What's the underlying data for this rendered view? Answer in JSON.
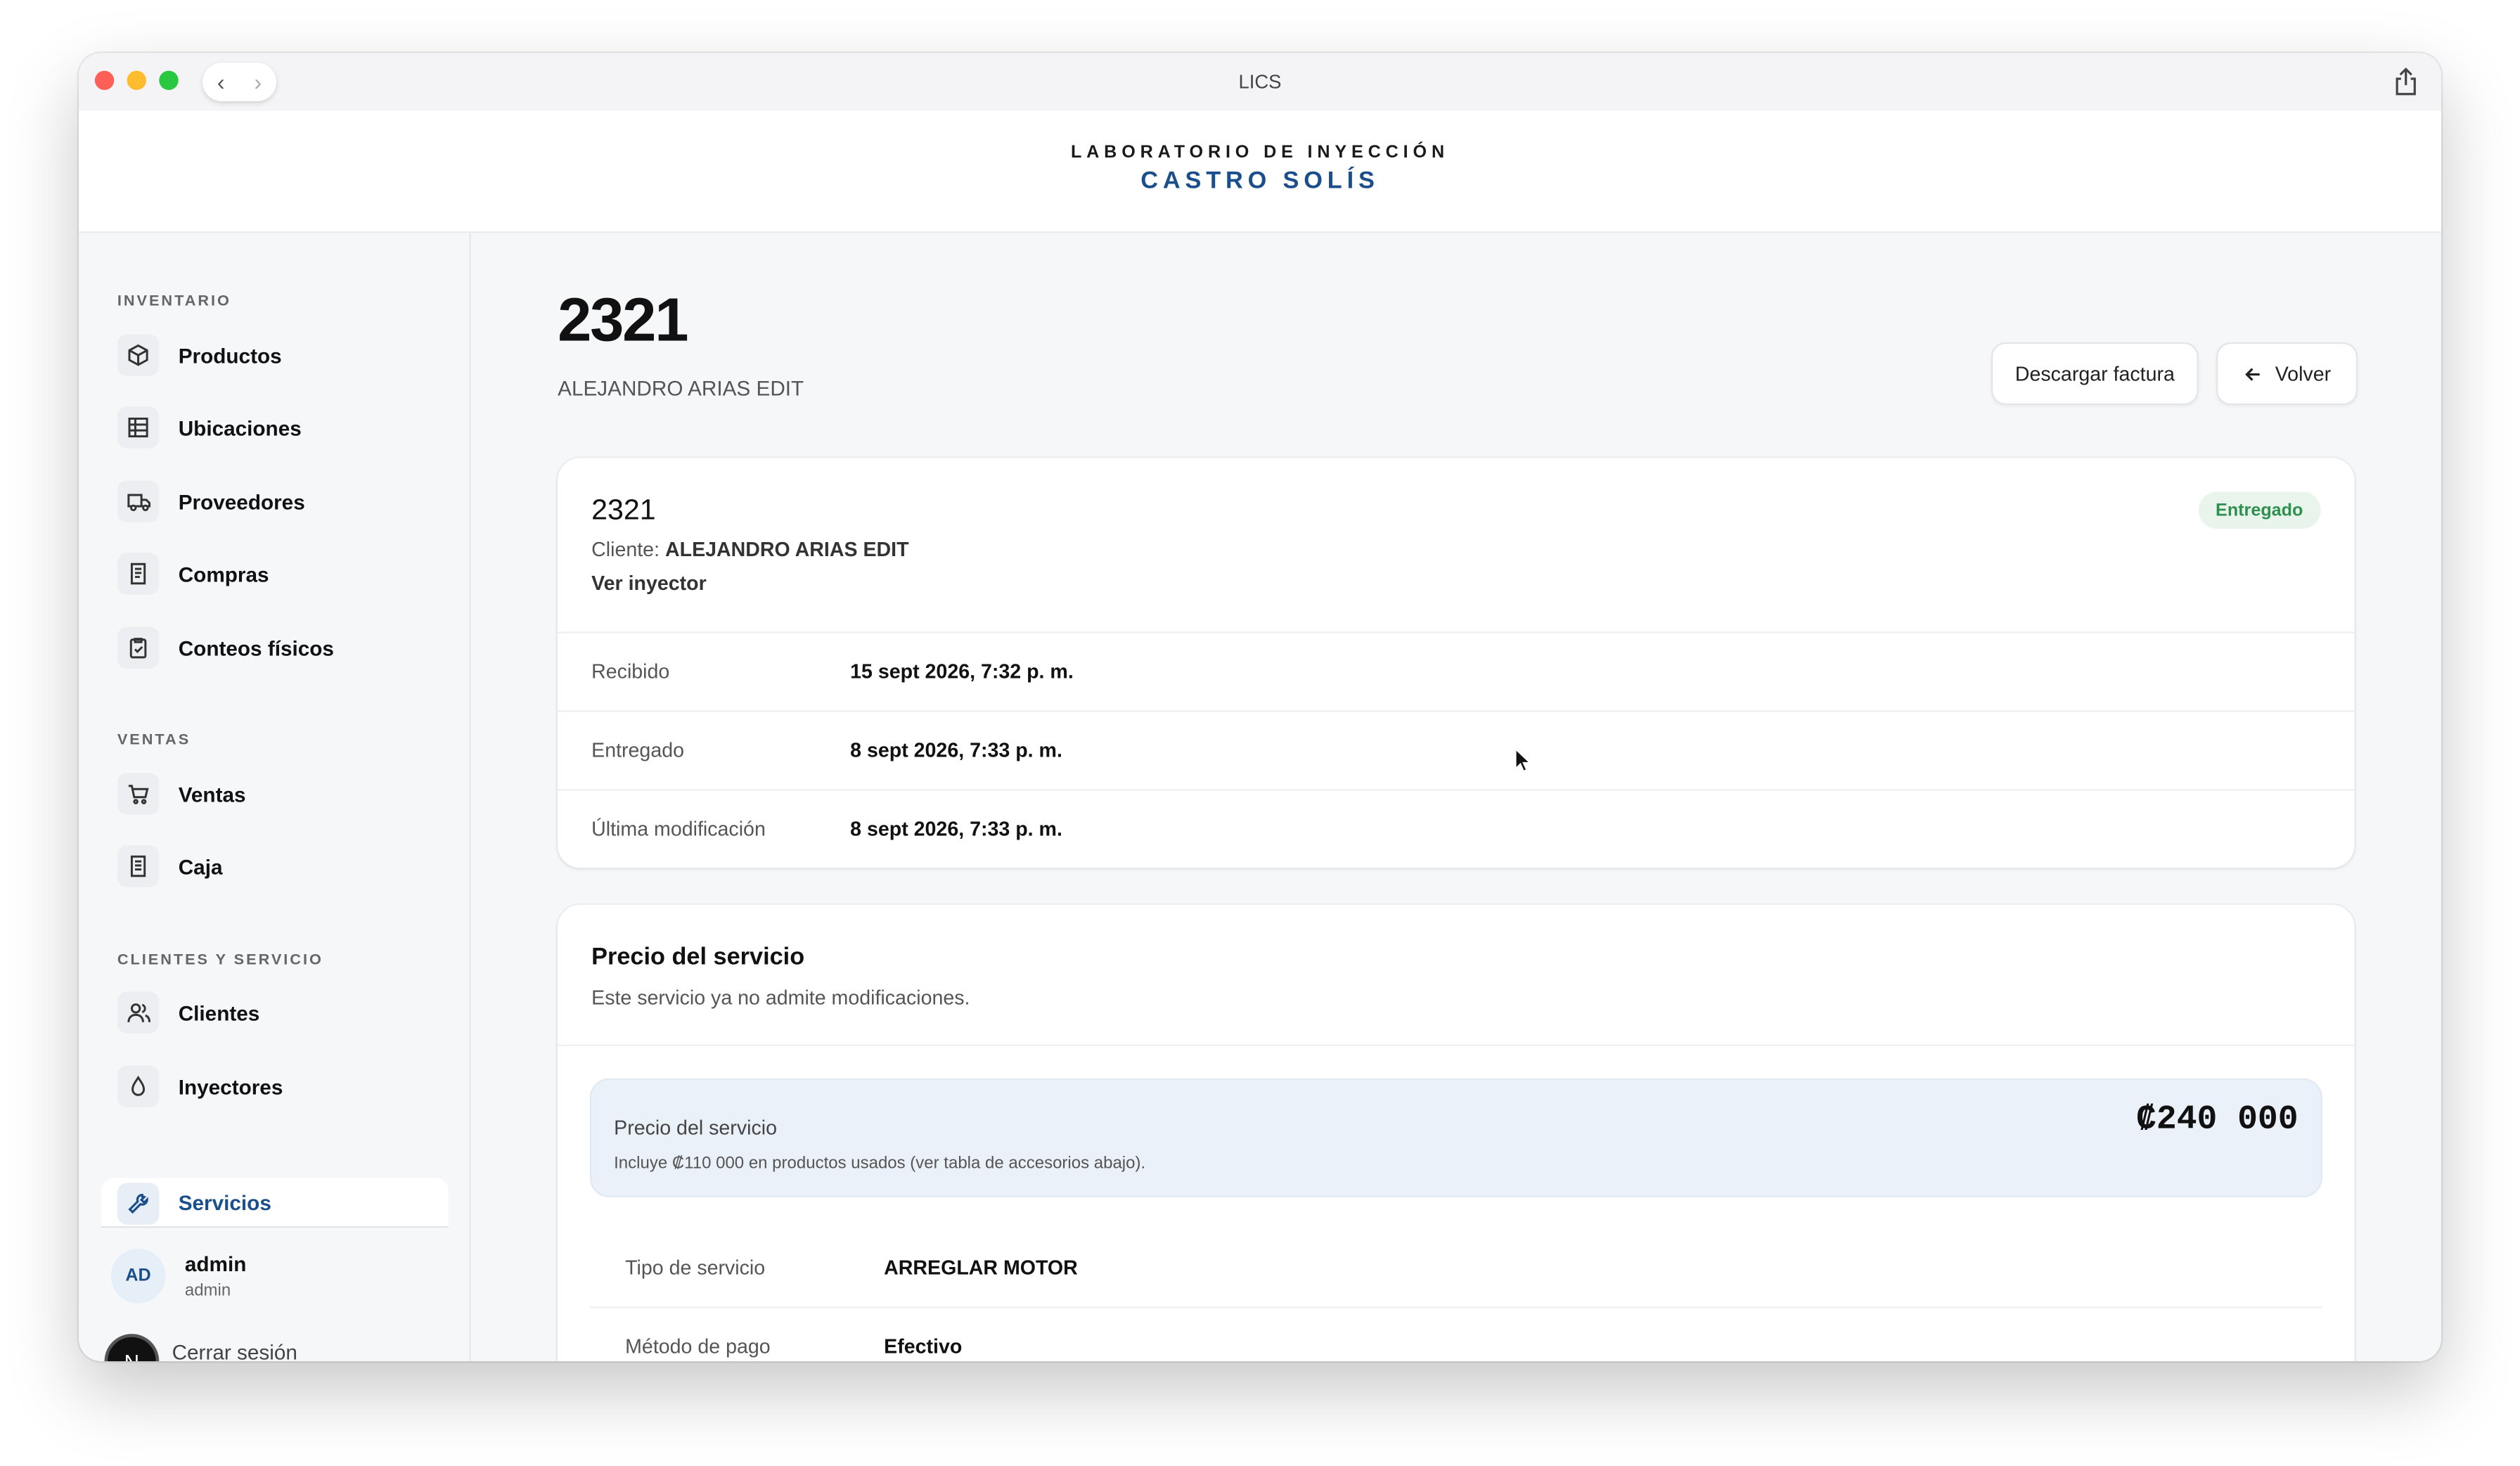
{
  "window": {
    "title": "LICS"
  },
  "brand": {
    "line1": "LABORATORIO DE INYECCIÓN",
    "line2": "CASTRO SOLÍS"
  },
  "sidebar": {
    "sections": [
      {
        "title": "INVENTARIO",
        "items": [
          {
            "label": "Productos",
            "icon": "box-icon"
          },
          {
            "label": "Ubicaciones",
            "icon": "grid-icon"
          },
          {
            "label": "Proveedores",
            "icon": "truck-icon"
          },
          {
            "label": "Compras",
            "icon": "receipt-icon"
          },
          {
            "label": "Conteos físicos",
            "icon": "clipboard-check-icon"
          }
        ]
      },
      {
        "title": "VENTAS",
        "items": [
          {
            "label": "Ventas",
            "icon": "cart-icon"
          },
          {
            "label": "Caja",
            "icon": "register-icon"
          }
        ]
      },
      {
        "title": "CLIENTES Y SERVICIO",
        "items": [
          {
            "label": "Clientes",
            "icon": "users-icon"
          },
          {
            "label": "Inyectores",
            "icon": "droplet-icon"
          },
          {
            "label": "Servicios",
            "icon": "wrench-icon",
            "active": true
          }
        ]
      }
    ],
    "user": {
      "initials": "AD",
      "name": "admin",
      "role": "admin"
    },
    "logout": "Cerrar sesión",
    "badge": "N"
  },
  "page": {
    "title": "2321",
    "subtitle": "ALEJANDRO ARIAS EDIT",
    "download_label": "Descargar factura",
    "back_label": "Volver"
  },
  "detail": {
    "id": "2321",
    "client_prefix": "Cliente:",
    "client_name": "ALEJANDRO ARIAS EDIT",
    "injector_link": "Ver inyector",
    "status": "Entregado",
    "status_color": "#2f8f4e",
    "rows": [
      {
        "label": "Recibido",
        "value": "15 sept 2026, 7:32 p. m."
      },
      {
        "label": "Entregado",
        "value": "8 sept 2026, 7:33 p. m."
      },
      {
        "label": "Última modificación",
        "value": "8 sept 2026, 7:33 p. m."
      }
    ]
  },
  "pricing": {
    "title": "Precio del servicio",
    "note": "Este servicio ya no admite modificaciones.",
    "box_label": "Precio del servicio",
    "box_sub": "Incluye ₡110 000 en productos usados (ver tabla de accesorios abajo).",
    "amount": "₡240 000",
    "rows": [
      {
        "label": "Tipo de servicio",
        "value": "ARREGLAR MOTOR"
      },
      {
        "label": "Método de pago",
        "value": "Efectivo"
      }
    ]
  },
  "colors": {
    "accent": "#1b4f8c",
    "price_box": "#eaf1f8"
  }
}
